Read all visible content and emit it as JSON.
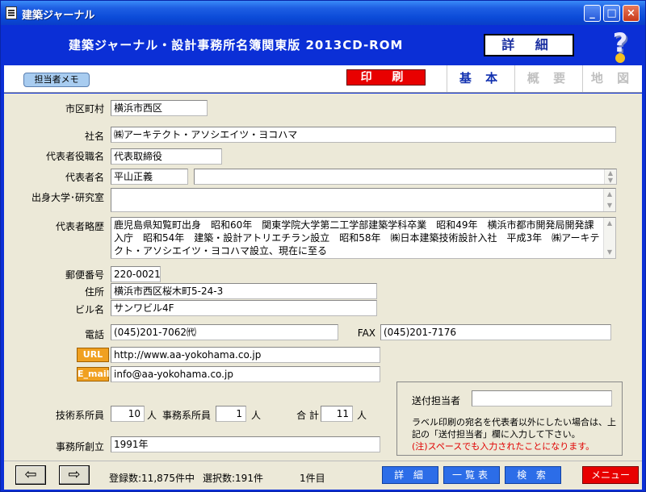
{
  "window": {
    "title": "建築ジャーナル"
  },
  "header": {
    "title": "建築ジャーナル・設計事務所名簿関東版 2013CD-ROM",
    "detail_label": "詳 細",
    "help_icon": "question-mark-icon"
  },
  "toolbar": {
    "memo_label": "担当者メモ",
    "print_label": "印 刷",
    "tabs": [
      {
        "label": "基 本",
        "state": "active"
      },
      {
        "label": "概 要",
        "state": "disabled"
      },
      {
        "label": "地 図",
        "state": "disabled"
      }
    ]
  },
  "form": {
    "city_label": "市区町村",
    "city": "横浜市西区",
    "company_label": "社名",
    "company": "㈱アーキテクト・アソシエイツ・ヨコハマ",
    "rep_title_label": "代表者役職名",
    "rep_title": "代表取締役",
    "rep_name_label": "代表者名",
    "rep_name": "平山正義",
    "rep_name_extra": "",
    "school_label": "出身大学･研究室",
    "school": "",
    "history_label": "代表者略歴",
    "history": "鹿児島県知覧町出身　昭和60年　関東学院大学第二工学部建築学科卒業　昭和49年　横浜市都市開発局開発課入庁　昭和54年　建築・設計アトリエチラン設立　昭和58年　㈱日本建築技術設計入社　平成3年　㈱アーキテクト・アソシエイツ・ヨコハマ設立、現在に至る",
    "zip_label": "郵便番号",
    "zip": "220-0021",
    "address_label": "住所",
    "address": "横浜市西区桜木町5-24-3",
    "building_label": "ビル名",
    "building": "サンワビル4F",
    "phone_label": "電話",
    "phone": "(045)201-7062㈹",
    "fax_label": "FAX",
    "fax": "(045)201-7176",
    "url_label": "URL",
    "url": "http://www.aa-yokohama.co.jp",
    "email_label": "E_mail",
    "email": "info@aa-yokohama.co.jp",
    "tech_staff_label": "技術系所員",
    "tech_staff": "10",
    "office_staff_label": "事務系所員",
    "office_staff": "1",
    "total_label": "合 計",
    "total": "11",
    "unit": "人",
    "founded_label": "事務所創立",
    "founded": "1991年"
  },
  "send_box": {
    "label": "送付担当者",
    "value": "",
    "note": "ラベル印刷の宛名を代表者以外にしたい場合は、上記の「送付担当者」欄に入力して下さい。",
    "warning": "(注)スペースでも入力されたことになります。"
  },
  "footer": {
    "prev_icon": "arrow-left-icon",
    "next_icon": "arrow-right-icon",
    "registered": "登録数:11,875件中",
    "selected": "選択数:191件",
    "current": "1件目",
    "buttons": {
      "detail": "詳 細",
      "list": "一覧表",
      "search": "検 索",
      "menu": "メニュー"
    }
  },
  "colors": {
    "header_blue": "#0b2fd6",
    "print_red": "#e80000",
    "badge_orange": "#f0a020",
    "button_blue": "#2c6de8"
  }
}
